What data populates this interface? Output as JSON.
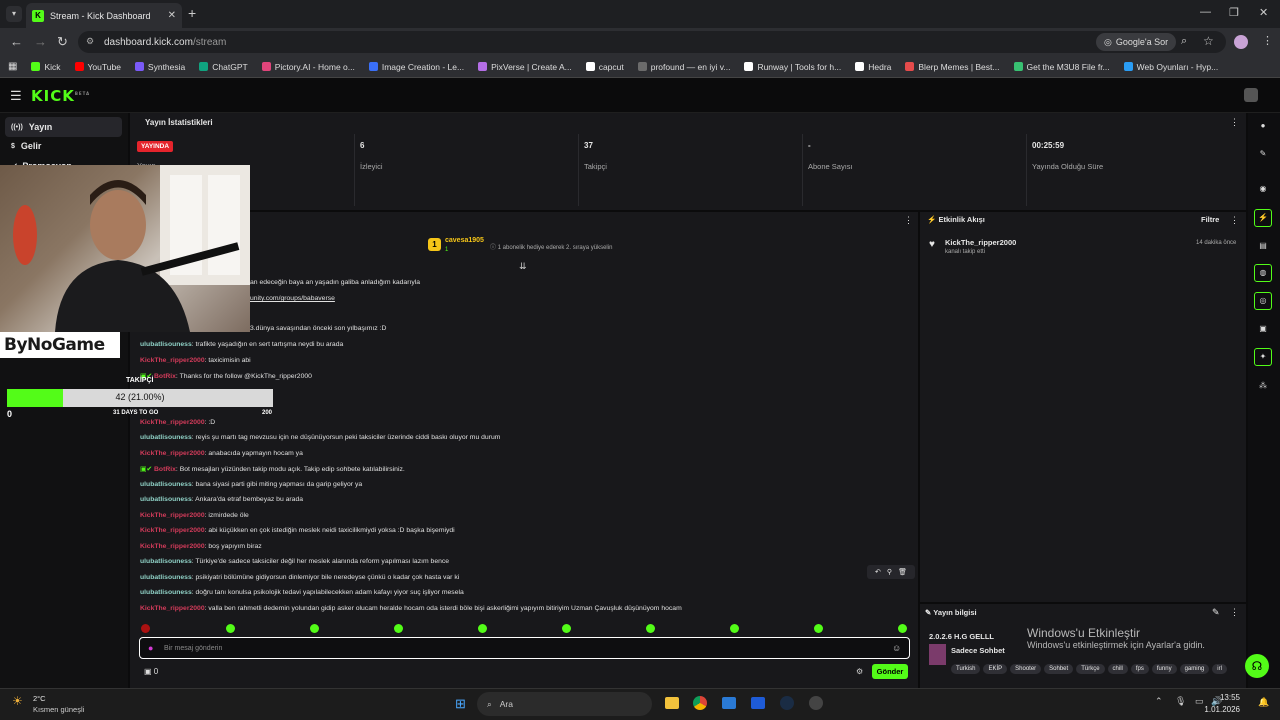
{
  "browser": {
    "tab_title": "Stream - Kick Dashboard",
    "url_host": "dashboard.kick.com",
    "url_path": "/stream",
    "google_sor": "Google'a Sor",
    "bookmarks": [
      "Kick",
      "YouTube",
      "Synthesia",
      "ChatGPT",
      "Pictory.AI - Home o...",
      "Image Creation - Le...",
      "PixVerse | Create A...",
      "capcut",
      "profound — en iyi v...",
      "Runway | Tools for h...",
      "Hedra",
      "Blerp Memes | Best...",
      "Get the M3U8 File fr...",
      "Web Oyunları - Hyp..."
    ]
  },
  "site": {
    "logo": "KICK",
    "beta": "BETA"
  },
  "sidebar": {
    "items": [
      "Yayın",
      "Gelir",
      "Promosyon"
    ]
  },
  "stats": {
    "title": "Yayın İstatistikleri",
    "live_badge": "YAYINDA",
    "status_label": "Yayın",
    "viewers": "6",
    "viewers_label": "İzleyici",
    "followers": "37",
    "followers_label": "Takipçi",
    "subs": "-",
    "subs_label": "Abone Sayısı",
    "uptime": "00:25:59",
    "uptime_label": "Yayında Olduğu Süre"
  },
  "overlay": {
    "brand": "ByNoGame",
    "goal_title": "TAKİPÇİ",
    "goal_text": "42 (21.00%)",
    "goal_progress": 0.21,
    "goal_min": "0",
    "goal_max": "200",
    "days_left": "31 DAYS TO GO"
  },
  "chat": {
    "top_gifter_name": "cavesa1905",
    "top_gifter_count": "1",
    "top_gifter_hint": "1 abonelik hediye ederek 2. sıraya yükselin",
    "messages": [
      {
        "user": "",
        "text": "an edeceğin baya an yaşadın galiba anladığım kadarıyla",
        "cls": "u1"
      },
      {
        "user": "",
        "text": "unity.com/groups/babaverse",
        "cls": "u1"
      },
      {
        "user": "",
        "text": "3.dünya savaşından önceki son yılbaşımız :D",
        "cls": "u1"
      },
      {
        "user": "ulubatlisouness",
        "text": ": trafikte yaşadığın en sert tartışma neydi bu arada",
        "cls": "u1"
      },
      {
        "user": "KickThe_ripper2000",
        "text": ": taxicimisin abi",
        "cls": "u2"
      },
      {
        "user": "BotRix",
        "text": ": Thanks for the follow @KickThe_ripper2000",
        "cls": "u3"
      },
      {
        "user": "KickThe_ripper2000",
        "text": ": :D",
        "cls": "u2"
      },
      {
        "user": "ulubatlisouness",
        "text": ": reyis şu martı tag mevzusu için ne düşünüyorsun peki taksiciler üzerinde ciddi baskı oluyor mu durum",
        "cls": "u1"
      },
      {
        "user": "KickThe_ripper2000",
        "text": ": anabacıda yapmayın hocam ya",
        "cls": "u2"
      },
      {
        "user": "BotRix",
        "text": ": Bot mesajları yüzünden takip modu açık. Takip edip sohbete katılabilirsiniz.",
        "cls": "u3"
      },
      {
        "user": "ulubatlisouness",
        "text": ": bana siyasi parti gibi miting yapması da garip geliyor ya",
        "cls": "u1"
      },
      {
        "user": "ulubatlisouness",
        "text": ": Ankara'da etraf bembeyaz bu arada",
        "cls": "u1"
      },
      {
        "user": "KickThe_ripper2000",
        "text": ": izmirdede öle",
        "cls": "u2"
      },
      {
        "user": "KickThe_ripper2000",
        "text": ": abi küçükken en çok istediğin meslek neidi taxicilikmiydi yoksa :D başka bişemiydi",
        "cls": "u2"
      },
      {
        "user": "KickThe_ripper2000",
        "text": ": boş yapıyım biraz",
        "cls": "u2"
      },
      {
        "user": "ulubatlisouness",
        "text": ": Türkiye'de sadece taksiciler değil her meslek alanında reform yapılması lazım bence",
        "cls": "u1"
      },
      {
        "user": "ulubatlisouness",
        "text": ": psikiyatri bölümüne gidiyorsun dinlemiyor bile neredeyse çünkü o kadar çok hasta var ki",
        "cls": "u1"
      },
      {
        "user": "ulubatlisouness",
        "text": ": doğru tanı konulsa psikolojik tedavi yapılabilecekken adam kafayı yiyor suç işliyor mesela",
        "cls": "u1"
      },
      {
        "user": "KickThe_ripper2000",
        "text": ": valla ben rahmetli dedemin yolundan gidip asker olucam heralde hocam oda isterdi böle bişi askerliğimi yapıyım bitiriyim Uzman Çavuşluk düşünüyom hocam",
        "cls": "u2"
      }
    ],
    "placeholder": "Bir mesaj gönderin",
    "send": "Gönder",
    "points": "0"
  },
  "activity": {
    "title": "Etkinlik Akışı",
    "filter": "Filtre",
    "event_user": "KickThe_ripper2000",
    "event_text": "kanalı takip etti",
    "event_time": "14 dakika önce"
  },
  "stream_info": {
    "title": "Yayın bilgisi",
    "stream_title": "2.0.2.6 H.G GELLL",
    "category": "Sadece Sohbet",
    "tags": [
      "Turkish",
      "EKİP",
      "Shooter",
      "Sohbet",
      "Türkçe",
      "chill",
      "fps",
      "funny",
      "gaming",
      "irl"
    ]
  },
  "watermark": {
    "line1": "Windows'u Etkinleştir",
    "line2": "Windows'u etkinleştirmek için Ayarlar'a gidin."
  },
  "taskbar": {
    "temp": "2°C",
    "weather": "Kısmen güneşli",
    "search": "Ara",
    "time": "13:55",
    "date": "1.01.2026"
  },
  "colors": {
    "accent": "#53fc18",
    "live": "#e5242c",
    "panel": "#18181b"
  }
}
